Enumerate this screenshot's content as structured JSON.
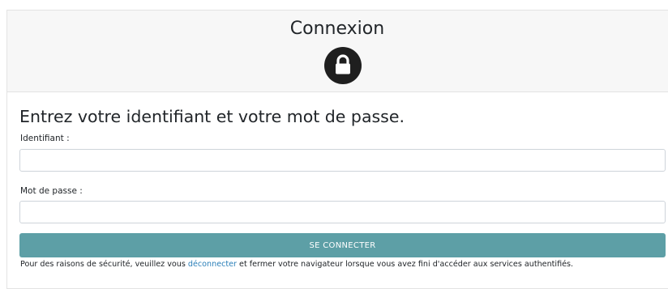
{
  "header": {
    "title": "Connexion",
    "icon": "lock-icon"
  },
  "form": {
    "heading": "Entrez votre identifiant et votre mot de passe.",
    "username_label": "Identifiant :",
    "username_value": "",
    "password_label": "Mot de passe :",
    "password_value": "",
    "submit_label": "SE CONNECTER"
  },
  "notice": {
    "before_link": "Pour des raisons de sécurité, veuillez vous ",
    "link_text": "déconnecter",
    "after_link": " et fermer votre navigateur lorsque vous avez fini d'accéder aux services authentifiés."
  },
  "colors": {
    "header_bg": "#f7f7f7",
    "button_bg": "#5d9fa6",
    "link": "#2a7fb8",
    "lock_badge": "#1f1f1f"
  }
}
